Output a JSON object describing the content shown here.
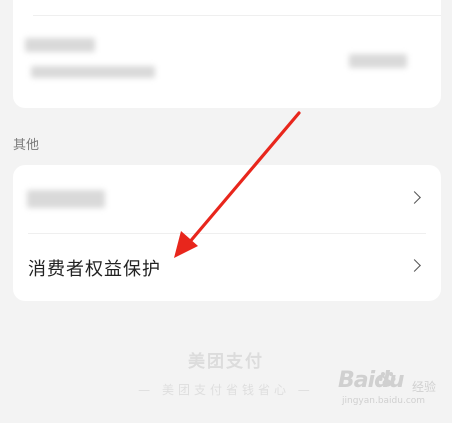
{
  "section": {
    "other_label": "其他"
  },
  "other_card": {
    "rows": [
      {
        "label": ""
      },
      {
        "label": "消费者权益保护"
      }
    ]
  },
  "footer": {
    "logo_text": "美团支付",
    "slogan": "— 美团支付省钱省心 —"
  },
  "watermark": {
    "main": "Baidu",
    "sub": "经验",
    "url": "jingyan.baidu.com"
  },
  "annotation": {
    "arrow_color": "#e8261c"
  },
  "icons": {
    "chevron": "chevron-right-icon",
    "watermark_paw": "paw-icon"
  }
}
